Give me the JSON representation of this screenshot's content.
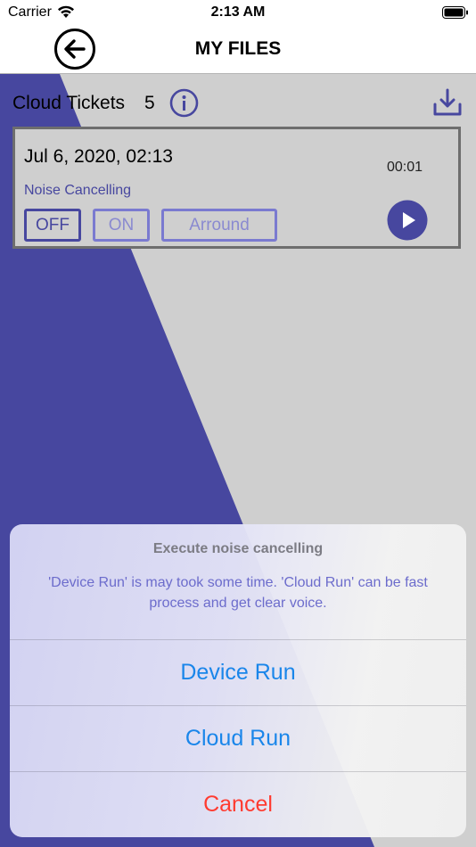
{
  "status_bar": {
    "carrier": "Carrier",
    "time": "2:13 AM"
  },
  "nav": {
    "title": "MY FILES"
  },
  "header": {
    "section_title": "Cloud Tickets",
    "count": "5"
  },
  "ticket": {
    "date": "Jul 6, 2020, 02:13",
    "duration": "00:01",
    "mode_label": "Noise Cancelling",
    "modes": [
      "OFF",
      "ON",
      "Arround"
    ],
    "selected_mode": "OFF"
  },
  "sheet": {
    "title": "Execute noise cancelling",
    "message": "'Device Run' is may took some time. 'Cloud Run' can be fast process and get clear voice.",
    "actions": [
      "Device Run",
      "Cloud Run"
    ],
    "cancel": "Cancel"
  },
  "colors": {
    "accent": "#47479f",
    "background_gray": "#cfcfcf",
    "action_blue": "#1a86ea",
    "destructive_red": "#ff3b30"
  }
}
